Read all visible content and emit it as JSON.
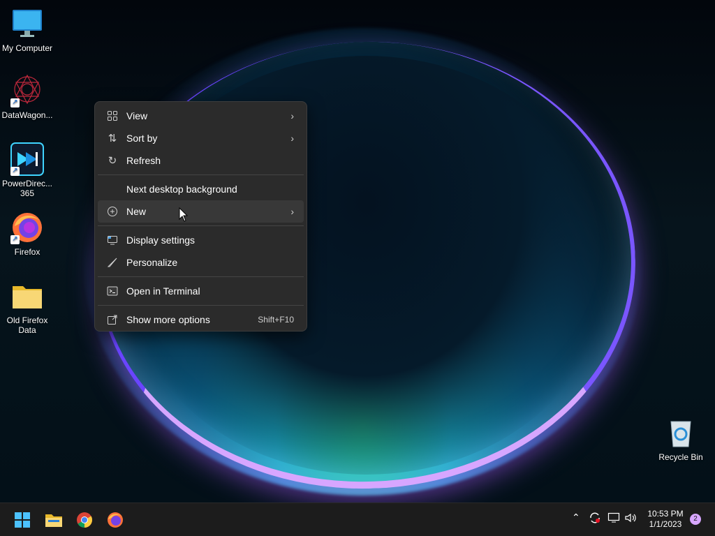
{
  "desktop": {
    "icons": [
      {
        "label": "My Computer"
      },
      {
        "label": "DataWagon..."
      },
      {
        "label": "PowerDirec... 365"
      },
      {
        "label": "Firefox"
      },
      {
        "label": "Old Firefox Data"
      },
      {
        "label": "Recycle Bin"
      }
    ]
  },
  "context_menu": {
    "items": [
      {
        "label": "View",
        "icon": "grid-icon",
        "submenu": true
      },
      {
        "label": "Sort by",
        "icon": "sort-icon",
        "submenu": true
      },
      {
        "label": "Refresh",
        "icon": "refresh-icon"
      },
      {
        "label": "Next desktop background"
      },
      {
        "label": "New",
        "icon": "plus-circle-icon",
        "submenu": true
      },
      {
        "label": "Display settings",
        "icon": "display-icon"
      },
      {
        "label": "Personalize",
        "icon": "brush-icon"
      },
      {
        "label": "Open in Terminal",
        "icon": "terminal-icon"
      },
      {
        "label": "Show more options",
        "icon": "share-icon",
        "shortcut": "Shift+F10"
      }
    ]
  },
  "taskbar": {
    "clock_time": "10:53 PM",
    "clock_date": "1/1/2023",
    "notification_count": "2",
    "pinned": [
      "start-icon",
      "file-explorer-icon",
      "chrome-icon",
      "firefox-icon"
    ]
  },
  "colors": {
    "menu_bg": "#2b2b2b",
    "taskbar_bg": "#1c1c1c",
    "accent": "#d7a6ff"
  }
}
